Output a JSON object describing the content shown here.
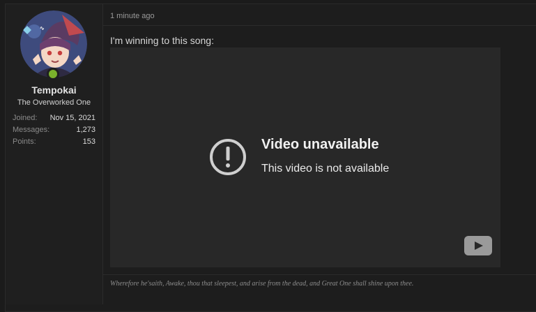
{
  "user": {
    "name": "Tempokai",
    "title": "The Overworked One",
    "stats": [
      {
        "key": "Joined:",
        "value": "Nov 15, 2021"
      },
      {
        "key": "Messages:",
        "value": "1,273"
      },
      {
        "key": "Points:",
        "value": "153"
      }
    ],
    "status_color": "#7bb12c"
  },
  "post": {
    "time": "1 minute ago",
    "text": "I'm winning to this song:",
    "signature": "Wherefore he'saith, Awake, thou that sleepest, and arise from the dead, and Great One shall shine upon thee."
  },
  "video": {
    "title": "Video unavailable",
    "subtitle": "This video is not available",
    "icon": "alert-circle-icon",
    "logo_icon": "youtube-icon"
  }
}
